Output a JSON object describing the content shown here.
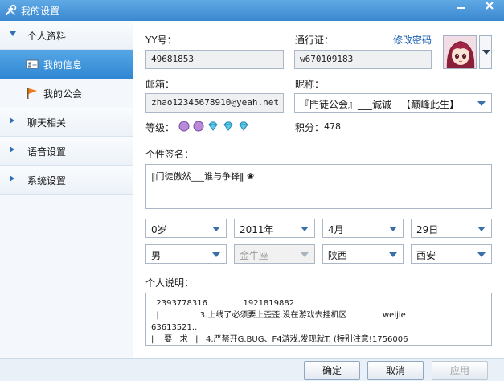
{
  "window": {
    "title": "我的设置"
  },
  "sidebar": {
    "sections": [
      {
        "label": "个人资料",
        "expanded": true,
        "children": [
          {
            "label": "我的信息",
            "active": true,
            "icon": "id-card-icon"
          },
          {
            "label": "我的公会",
            "active": false,
            "icon": "flag-icon"
          }
        ]
      },
      {
        "label": "聊天相关",
        "expanded": false
      },
      {
        "label": "语音设置",
        "expanded": false
      },
      {
        "label": "系统设置",
        "expanded": false
      }
    ]
  },
  "profile": {
    "yy_label": "YY号：",
    "yy_value": "49681853",
    "passport_label": "通行证：",
    "passport_value": "w670109183",
    "change_password_link": "修改密码",
    "email_label": "邮箱：",
    "email_value": "zhao12345678910@yeah.net",
    "nickname_label": "昵称：",
    "nickname_value": "『門徒公会』___诚诚一【巅峰此生】",
    "level_label": "等级：",
    "level_icons": [
      "moon-icon",
      "moon-icon",
      "diamond-icon",
      "diamond-icon",
      "diamond-icon"
    ],
    "points_label": "积分：",
    "points_value": "478",
    "signature_label": "个性签名：",
    "signature_value": "‖门徒傲然___谁与争锋‖ ❀",
    "age": "0岁",
    "year": "2011年",
    "month": "4月",
    "day": "29日",
    "gender": "男",
    "zodiac": "金牛座",
    "province": "陕西",
    "city": "西安",
    "description_label": "个人说明：",
    "description_lines": [
      "  2393778316              1921819882",
      "  |            |   3.上线了必须要上歪歪.没在游戏去挂机区              weijie",
      "63613521..",
      "|    要   求   |   4.严禁开G.BUG、F4游戏,发现就T. (特别注意!1756006"
    ]
  },
  "buttons": {
    "ok": "确定",
    "cancel": "取消",
    "apply": "应用"
  },
  "colors": {
    "titlebar": "#3b88d0",
    "active_item": "#2f86d2",
    "link": "#1a5fb4"
  }
}
